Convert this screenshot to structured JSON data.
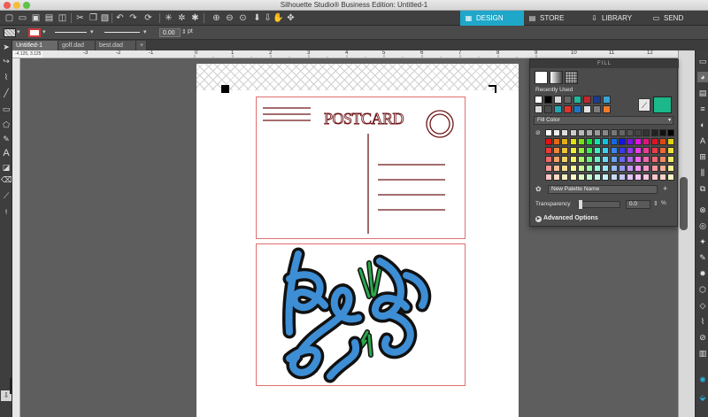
{
  "window": {
    "title": "Silhouette Studio® Business Edition: Untitled-1"
  },
  "nav_tabs": [
    {
      "label": "DESIGN",
      "icon": "grid-icon",
      "active": true
    },
    {
      "label": "STORE",
      "icon": "store-icon",
      "active": false
    },
    {
      "label": "LIBRARY",
      "icon": "library-icon",
      "active": false
    },
    {
      "label": "SEND",
      "icon": "send-icon",
      "active": false
    }
  ],
  "line_options": {
    "stroke_width": "0.00",
    "unit": "pt"
  },
  "doc_tabs": [
    {
      "label": "Untitled-1",
      "active": true
    },
    {
      "label": "golf.dad",
      "active": false
    },
    {
      "label": "best.dad",
      "active": false
    },
    {
      "label": "+",
      "active": false
    }
  ],
  "coords": "-4.125, 3.125",
  "ruler_top": [
    "-3",
    "-2",
    "-1",
    "0",
    "1",
    "2",
    "3",
    "4",
    "5",
    "6",
    "7",
    "8",
    "9",
    "10",
    "11",
    "12"
  ],
  "canvas": {
    "postcard": {
      "title": "POSTCARD"
    },
    "colors": {
      "postcard_line": "#6e1618",
      "cut_border": "#e07070",
      "design_blue": "#3d8ed4",
      "design_green": "#2aa84a",
      "outline": "#111111"
    }
  },
  "fill_panel": {
    "header": "FILL",
    "recently_used_label": "Recently Used",
    "recently_used": [
      "#ffffff",
      "#000000",
      "#d9d9d9",
      "#666666",
      "#1fb89a",
      "#c0272d",
      "#1b3a8c",
      "#3ba3d4",
      "#d9d9d9",
      "#4b4b4b",
      "#22a7b5",
      "#e0322a",
      "#1a77c4",
      "#e2e2e2",
      "#7d7d7d",
      "#f27c2b"
    ],
    "selected_color": "#1bb88a",
    "fill_color_label": "Fill Color",
    "palette_grays": [
      "#ffffff",
      "#eeeeee",
      "#dddddd",
      "#cccccc",
      "#bbbbbb",
      "#aaaaaa",
      "#999999",
      "#888888",
      "#777777",
      "#666666",
      "#555555",
      "#444444",
      "#333333",
      "#222222",
      "#111111",
      "#000000"
    ],
    "palette_name_placeholder": "New Palette Name",
    "transparency_label": "Transparency",
    "transparency_value": "0.0",
    "transparency_unit": "%",
    "advanced_options_label": "Advanced Options"
  }
}
